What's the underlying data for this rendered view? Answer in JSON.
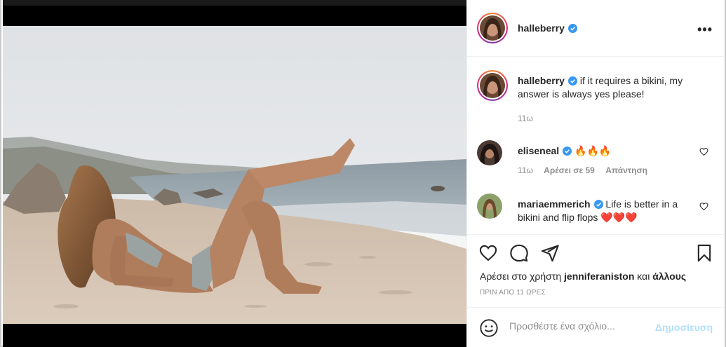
{
  "post": {
    "username": "halleberry",
    "more_icon": "more-options-icon"
  },
  "caption": {
    "username": "halleberry",
    "text": "if it requires a bikini, my answer is always yes please!",
    "time": "11ω"
  },
  "comments": [
    {
      "username": "eliseneal",
      "text": "🔥🔥🔥",
      "time": "11ω",
      "likes": "Αρέσει σε 59",
      "reply": "Απάντηση"
    },
    {
      "username": "mariaemmerich",
      "text": "Life is better in a bikini and flip flops ❤️❤️❤️",
      "time": "",
      "likes": "",
      "reply": ""
    }
  ],
  "likes": {
    "prefix": "Αρέσει στο χρήστη",
    "user": "jenniferaniston",
    "conj": "και",
    "others": "άλλους"
  },
  "time_ago": "ΠΡΙΝ ΑΠΟ 11 ΩΡΕΣ",
  "add_comment": {
    "placeholder": "Προσθέστε ένα σχόλιο...",
    "post_label": "Δημοσίευση"
  },
  "colors": {
    "verified": "#3897f0",
    "post_disabled": "#b2dffc",
    "heart_emoji": "#ed1c24"
  }
}
